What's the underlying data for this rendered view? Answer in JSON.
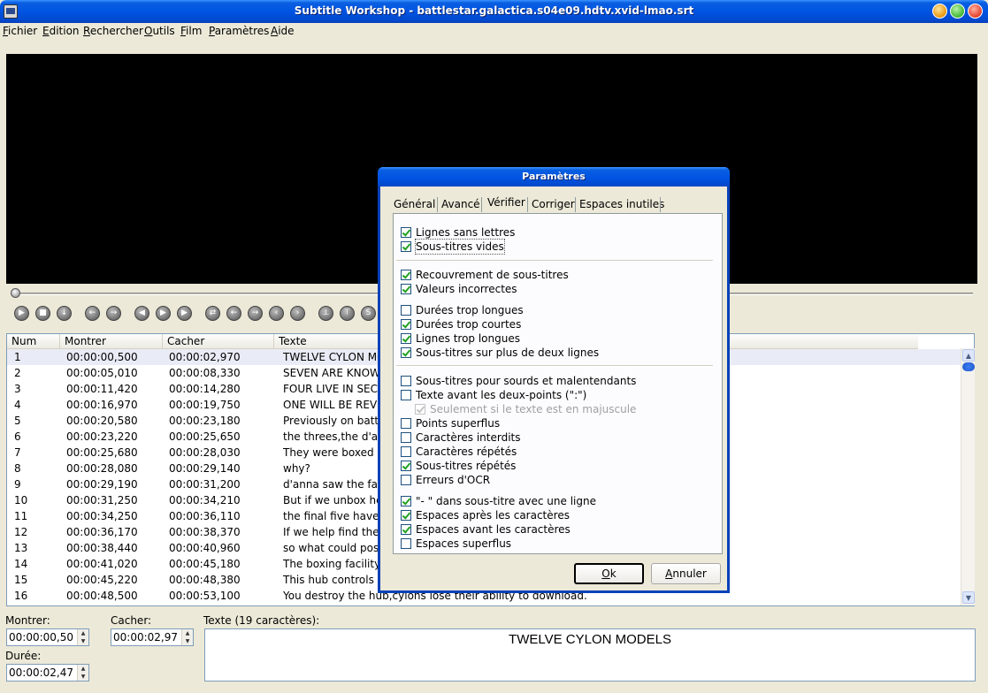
{
  "window": {
    "title": "Subtitle Workshop - battlestar.galactica.s04e09.hdtv.xvid-lmao.srt"
  },
  "menu": [
    "Fichier",
    "Edition",
    "Rechercher",
    "Outils",
    "Film",
    "Paramètres",
    "Aide"
  ],
  "list": {
    "columns": [
      "Num",
      "Montrer",
      "Cacher",
      "Texte"
    ],
    "rows": [
      {
        "num": "1",
        "show": "00:00:00,500",
        "hide": "00:00:02,970",
        "text": "TWELVE CYLON MO"
      },
      {
        "num": "2",
        "show": "00:00:05,010",
        "hide": "00:00:08,330",
        "text": "SEVEN ARE KNOWN"
      },
      {
        "num": "3",
        "show": "00:00:11,420",
        "hide": "00:00:14,280",
        "text": "FOUR LIVE IN SECR"
      },
      {
        "num": "4",
        "show": "00:00:16,970",
        "hide": "00:00:19,750",
        "text": "ONE WILL BE REVE"
      },
      {
        "num": "5",
        "show": "00:00:20,580",
        "hide": "00:00:23,180",
        "text": "Previously on battle"
      },
      {
        "num": "6",
        "show": "00:00:23,220",
        "hide": "00:00:25,650",
        "text": "the threes,the d'an"
      },
      {
        "num": "7",
        "show": "00:00:25,680",
        "hide": "00:00:28,030",
        "text": "They were boxed a"
      },
      {
        "num": "8",
        "show": "00:00:28,080",
        "hide": "00:00:29,140",
        "text": "why?"
      },
      {
        "num": "9",
        "show": "00:00:29,190",
        "hide": "00:00:31,200",
        "text": "d'anna saw the face"
      },
      {
        "num": "10",
        "show": "00:00:31,250",
        "hide": "00:00:34,210",
        "text": "But if we unbox her"
      },
      {
        "num": "11",
        "show": "00:00:34,250",
        "hide": "00:00:36,110",
        "text": "the final five have b"
      },
      {
        "num": "12",
        "show": "00:00:36,170",
        "hide": "00:00:38,370",
        "text": "If we help find them"
      },
      {
        "num": "13",
        "show": "00:00:38,440",
        "hide": "00:00:40,960",
        "text": "so what could possi"
      },
      {
        "num": "14",
        "show": "00:00:41,020",
        "hide": "00:00:45,180",
        "text": "The boxing facility r"
      },
      {
        "num": "15",
        "show": "00:00:45,220",
        "hide": "00:00:48,380",
        "text": "This hub controls th"
      },
      {
        "num": "16",
        "show": "00:00:48,500",
        "hide": "00:00:53,100",
        "text": "You destroy the hub,cylons lose their ability to download."
      }
    ]
  },
  "editor": {
    "show_label": "Montrer:",
    "show_value": "00:00:00,50",
    "hide_label": "Cacher:",
    "hide_value": "00:00:02,97",
    "duration_label": "Durée:",
    "duration_value": "00:00:02,47",
    "text_label": "Texte (19 caractères):",
    "text_value": "TWELVE CYLON MODELS"
  },
  "dialog": {
    "title": "Paramètres",
    "tabs": [
      "Général",
      "Avancé",
      "Vérifier",
      "Corriger",
      "Espaces inutiles"
    ],
    "active_tab": "Vérifier",
    "checks": [
      {
        "label": "Lignes sans lettres",
        "checked": true
      },
      {
        "label": "Sous-titres vides",
        "checked": true
      },
      {
        "label": "Recouvrement de sous-titres",
        "checked": true
      },
      {
        "label": "Valeurs incorrectes",
        "checked": true
      },
      {
        "label": "Durées trop longues",
        "checked": false
      },
      {
        "label": "Durées trop courtes",
        "checked": true
      },
      {
        "label": "Lignes trop longues",
        "checked": true
      },
      {
        "label": "Sous-titres sur plus de deux lignes",
        "checked": true
      },
      {
        "label": "Sous-titres pour sourds et malentendants",
        "checked": false
      },
      {
        "label": "Texte avant les deux-points (\":\")",
        "checked": false
      },
      {
        "label": "Seulement si le texte est en majuscule",
        "checked": true,
        "disabled": true
      },
      {
        "label": "Points superflus",
        "checked": false
      },
      {
        "label": "Caractères interdits",
        "checked": false
      },
      {
        "label": "Caractères répétés",
        "checked": false
      },
      {
        "label": "Sous-titres répétés",
        "checked": true
      },
      {
        "label": "Erreurs d'OCR",
        "checked": false
      },
      {
        "label": "\"- \" dans sous-titre avec une ligne",
        "checked": true
      },
      {
        "label": "Espaces après les caractères",
        "checked": true
      },
      {
        "label": "Espaces avant les caractères",
        "checked": true
      },
      {
        "label": "Espaces superflus",
        "checked": false
      }
    ],
    "ok_label": "Ok",
    "cancel_label": "Annuler"
  },
  "controls": [
    "play-icon",
    "stop-icon",
    "download-icon",
    "back-icon",
    "forward-icon",
    "rewind-icon",
    "fast-forward-icon",
    "step-icon",
    "sync-icon",
    "set-start-icon",
    "set-end-icon",
    "start-subtitle-icon",
    "end-subtitle-icon",
    "mark-start-icon",
    "mark-end-icon",
    "save-subtitle-icon"
  ]
}
